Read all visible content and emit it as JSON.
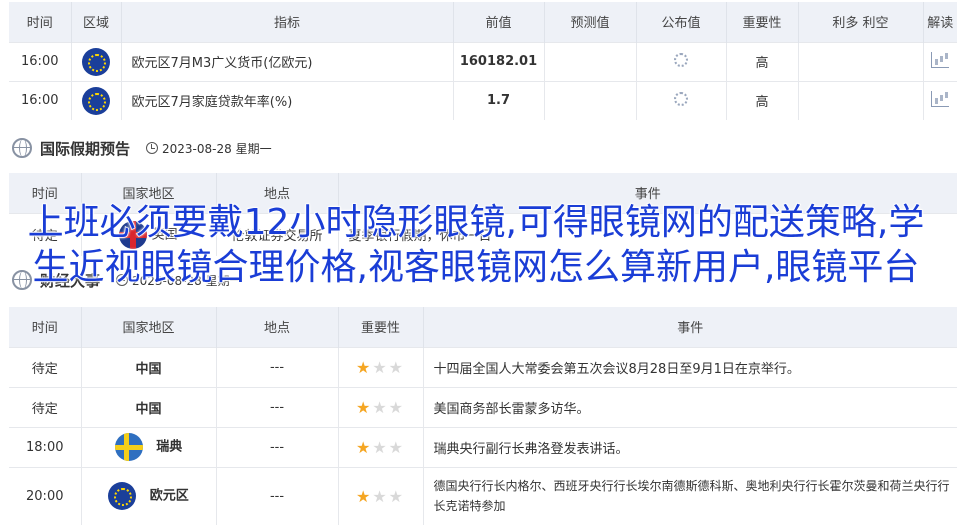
{
  "econ_table": {
    "headers": [
      "时间",
      "区域",
      "指标",
      "前值",
      "预测值",
      "公布值",
      "重要性",
      "利多 利空",
      "解读"
    ],
    "rows": [
      {
        "time": "16:00",
        "flag_icon": "eu-flag-icon",
        "indicator": "欧元区7月M3广义货币(亿欧元)",
        "previous": "160182.01",
        "importance": "高"
      },
      {
        "time": "16:00",
        "flag_icon": "eu-flag-icon",
        "indicator": "欧元区7月家庭贷款年率(%)",
        "previous": "1.7",
        "importance": "高"
      }
    ]
  },
  "holiday_section": {
    "title": "国际假期预告",
    "date": "2023-08-28 星期一",
    "headers": [
      "时间",
      "国家地区",
      "地点",
      "事件"
    ],
    "row": {
      "time": "待定",
      "country": "英国",
      "location": "伦敦证券交易所",
      "event": "夏季银行假期，休市一日"
    }
  },
  "finance_section": {
    "title": "财经大事",
    "date": "2023-08-28 星期一",
    "headers": [
      "时间",
      "国家地区",
      "地点",
      "重要性",
      "事件"
    ],
    "rows": [
      {
        "time": "待定",
        "country": "中国",
        "location": "---",
        "stars": 1,
        "event": "十四届全国人大常委会第五次会议8月28日至9月1日在京举行。"
      },
      {
        "time": "待定",
        "country": "中国",
        "location": "---",
        "stars": 1,
        "event": "美国商务部长雷蒙多访华。"
      },
      {
        "time": "18:00",
        "country": "瑞典",
        "flag_icon": "sweden-flag-icon",
        "location": "---",
        "stars": 1,
        "event": "瑞典央行副行长弗洛登发表讲话。"
      },
      {
        "time": "20:00",
        "country": "欧元区",
        "flag_icon": "eu-flag-icon",
        "location": "---",
        "stars": 1,
        "event": "德国央行行长内格尔、西班牙央行行长埃尔南德斯德科斯、奥地利央行行长霍尔茨曼和荷兰央行行长克诺特参加"
      }
    ]
  },
  "overlay_text": "上班必须要戴12小时隐形眼镜,可得眼镜网的配送策略,学生近视眼镜合理价格,视客眼镜网怎么算新用户,眼镜平台",
  "colors": {
    "header_bg": "#eef1f7",
    "accent_red": "#d0021b",
    "overlay_blue": "#1a3dd6",
    "star": "#f5a623"
  }
}
